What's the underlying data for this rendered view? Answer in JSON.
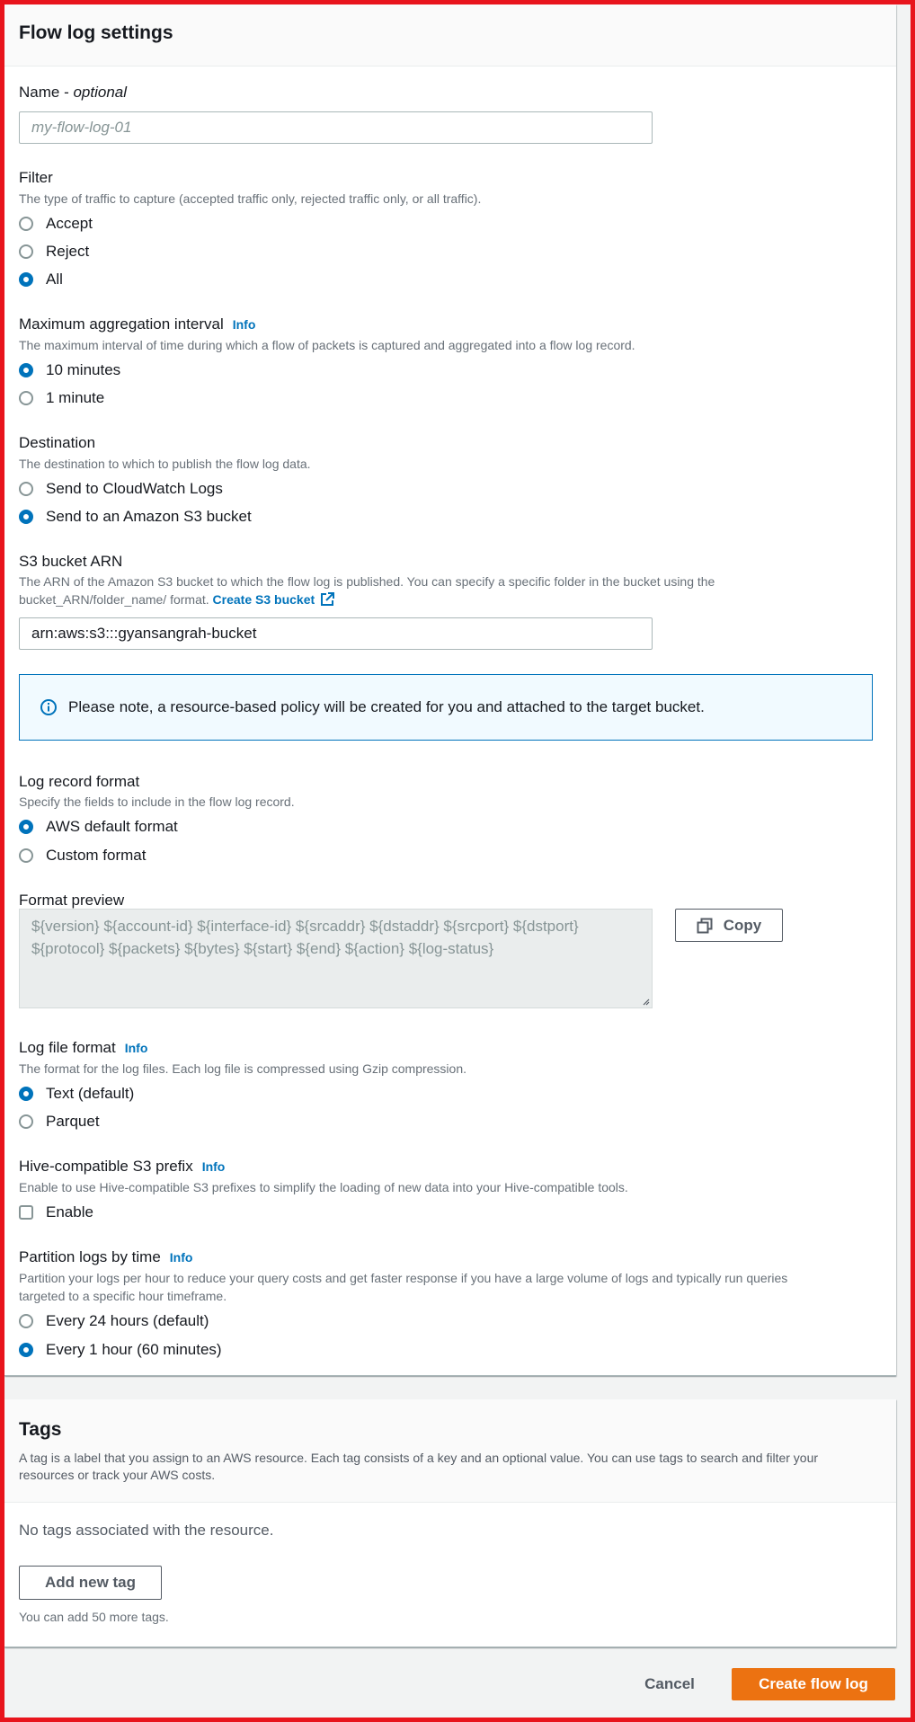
{
  "flow_log_settings": {
    "title": "Flow log settings",
    "name": {
      "label": "Name - ",
      "label_optional": "optional",
      "placeholder": "my-flow-log-01",
      "value": ""
    },
    "filter": {
      "label": "Filter",
      "description": "The type of traffic to capture (accepted traffic only, rejected traffic only, or all traffic).",
      "options": [
        {
          "label": "Accept",
          "selected": false
        },
        {
          "label": "Reject",
          "selected": false
        },
        {
          "label": "All",
          "selected": true
        }
      ]
    },
    "aggregation": {
      "label": "Maximum aggregation interval",
      "info": "Info",
      "description": "The maximum interval of time during which a flow of packets is captured and aggregated into a flow log record.",
      "options": [
        {
          "label": "10 minutes",
          "selected": true
        },
        {
          "label": "1 minute",
          "selected": false
        }
      ]
    },
    "destination": {
      "label": "Destination",
      "description": "The destination to which to publish the flow log data.",
      "options": [
        {
          "label": "Send to CloudWatch Logs",
          "selected": false
        },
        {
          "label": "Send to an Amazon S3 bucket",
          "selected": true
        }
      ]
    },
    "s3_arn": {
      "label": "S3 bucket ARN",
      "description_line1": "The ARN of the Amazon S3 bucket to which the flow log is published. You can specify a specific folder in the bucket using the",
      "description_line2": "bucket_ARN/folder_name/ format.",
      "create_link": "Create S3 bucket",
      "value": "arn:aws:s3:::gyansangrah-bucket"
    },
    "alert": {
      "text": "Please note, a resource-based policy will be created for you and attached to the target bucket."
    },
    "log_record_format": {
      "label": "Log record format",
      "description": "Specify the fields to include in the flow log record.",
      "options": [
        {
          "label": "AWS default format",
          "selected": true
        },
        {
          "label": "Custom format",
          "selected": false
        }
      ]
    },
    "format_preview": {
      "label": "Format preview",
      "text": "${version} ${account-id} ${interface-id} ${srcaddr} ${dstaddr} ${srcport} ${dstport} ${protocol} ${packets} ${bytes} ${start} ${end} ${action} ${log-status}",
      "copy_label": "Copy"
    },
    "log_file_format": {
      "label": "Log file format",
      "info": "Info",
      "description": "The format for the log files. Each log file is compressed using Gzip compression.",
      "options": [
        {
          "label": "Text (default)",
          "selected": true
        },
        {
          "label": "Parquet",
          "selected": false
        }
      ]
    },
    "hive": {
      "label": "Hive-compatible S3 prefix",
      "info": "Info",
      "description": "Enable to use Hive-compatible S3 prefixes to simplify the loading of new data into your Hive-compatible tools.",
      "checkbox_label": "Enable",
      "checked": false
    },
    "partition": {
      "label": "Partition logs by time",
      "info": "Info",
      "description_line1": "Partition your logs per hour to reduce your query costs and get faster response if you have a large volume of logs and typically run queries",
      "description_line2": "targeted to a specific hour timeframe.",
      "options": [
        {
          "label": "Every 24 hours (default)",
          "selected": false
        },
        {
          "label": "Every 1 hour (60 minutes)",
          "selected": true
        }
      ]
    }
  },
  "tags": {
    "title": "Tags",
    "description": "A tag is a label that you assign to an AWS resource. Each tag consists of a key and an optional value. You can use tags to search and filter your resources or track your AWS costs.",
    "empty_text": "No tags associated with the resource.",
    "add_button": "Add new tag",
    "hint": "You can add 50 more tags."
  },
  "footer": {
    "cancel": "Cancel",
    "create": "Create flow log"
  },
  "colors": {
    "accent_blue": "#0073bb",
    "primary_orange": "#ec7211",
    "frame_red": "#e8141c"
  }
}
